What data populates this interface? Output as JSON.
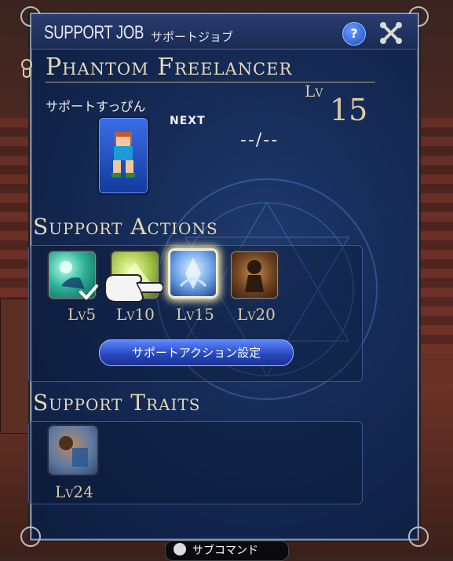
{
  "header": {
    "title": "SUPPORT JOB",
    "subtitle": "サポートジョブ",
    "help_icon": "question-icon",
    "help_label": "?",
    "close_icon": "crossed-tools-icon"
  },
  "job": {
    "icon": "phantom-job-icon",
    "name": "Phantom Freelancer",
    "name_jp": "サポートすっぴん",
    "level_label": "Lv",
    "level": "15",
    "next_label": "NEXT",
    "exp": "--/--"
  },
  "support_actions": {
    "title": "Support Actions",
    "items": [
      {
        "level": "Lv5",
        "icon": "teal-burst-action-icon",
        "learned": true
      },
      {
        "level": "Lv10",
        "icon": "green-action-icon",
        "learned": false
      },
      {
        "level": "Lv15",
        "icon": "blue-aura-action-icon",
        "learned": false,
        "highlighted": true
      },
      {
        "level": "Lv20",
        "icon": "brown-action-icon",
        "learned": false
      }
    ],
    "button_label": "サポートアクション設定"
  },
  "support_traits": {
    "title": "Support Traits",
    "items": [
      {
        "level": "Lv24",
        "icon": "trait-icon"
      }
    ]
  },
  "footer": {
    "subcommand_label": "サブコマンド"
  },
  "colors": {
    "window_bg": "#152a55",
    "gold_text": "#e7d9b8",
    "button_blue": "#2446b8"
  }
}
